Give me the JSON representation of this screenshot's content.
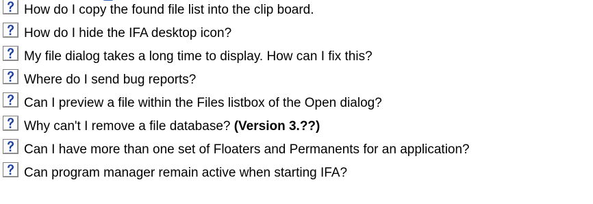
{
  "faq": {
    "items": [
      {
        "question": "How do I copy the found file list into the clip board.",
        "note": ""
      },
      {
        "question": "How do I hide the IFA desktop icon?",
        "note": ""
      },
      {
        "question": "My file dialog takes a long time to display. How can I fix this?",
        "note": ""
      },
      {
        "question": "Where do I send bug reports?",
        "note": ""
      },
      {
        "question": "Can I preview a file within the Files listbox of the Open dialog?",
        "note": ""
      },
      {
        "question": "Why can't I remove a file database? ",
        "note": "(Version 3.??)"
      },
      {
        "question": "Can I have more than one set of Floaters and Permanents for an application?",
        "note": ""
      },
      {
        "question": "Can program manager remain active when starting IFA?",
        "note": ""
      }
    ],
    "icon": "help-question-icon",
    "colors": {
      "icon_face": "#ffffff",
      "icon_border": "#7f7f7f",
      "icon_mark": "#1a3f9f",
      "icon_shadow": "#9a9a9a",
      "title_link": "#2b5fb0",
      "text": "#000000"
    }
  }
}
